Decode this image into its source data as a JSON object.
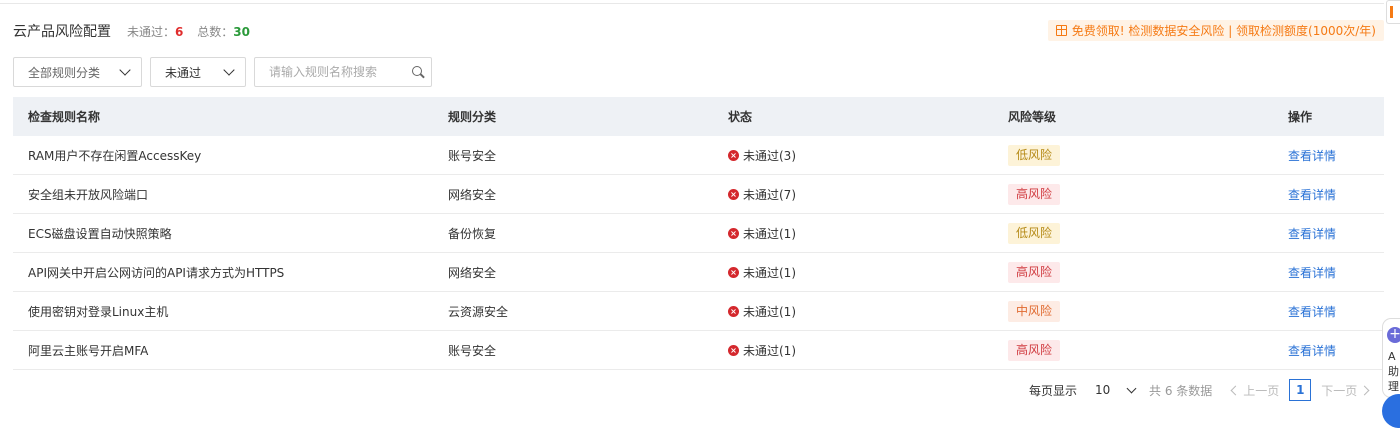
{
  "header": {
    "title": "云产品风险配置",
    "fail_label": "未通过：",
    "fail_count": "6",
    "total_label": "总数：",
    "total_count": "30"
  },
  "promo": {
    "text": "免费领取! 检测数据安全风险 | 领取检测额度(1000次/年)"
  },
  "filters": {
    "category": "全部规则分类",
    "status": "未通过",
    "search_placeholder": "请输入规则名称搜索"
  },
  "table": {
    "columns": [
      "检查规则名称",
      "规则分类",
      "状态",
      "风险等级",
      "操作"
    ],
    "rows": [
      {
        "name": "RAM用户不存在闲置AccessKey",
        "category": "账号安全",
        "status": "未通过(3)",
        "risk": "低风险",
        "action": "查看详情"
      },
      {
        "name": "安全组未开放风险端口",
        "category": "网络安全",
        "status": "未通过(7)",
        "risk": "高风险",
        "action": "查看详情"
      },
      {
        "name": "ECS磁盘设置自动快照策略",
        "category": "备份恢复",
        "status": "未通过(1)",
        "risk": "低风险",
        "action": "查看详情"
      },
      {
        "name": "API网关中开启公网访问的API请求方式为HTTPS",
        "category": "网络安全",
        "status": "未通过(1)",
        "risk": "高风险",
        "action": "查看详情"
      },
      {
        "name": "使用密钥对登录Linux主机",
        "category": "云资源安全",
        "status": "未通过(1)",
        "risk": "中风险",
        "action": "查看详情"
      },
      {
        "name": "阿里云主账号开启MFA",
        "category": "账号安全",
        "status": "未通过(1)",
        "risk": "高风险",
        "action": "查看详情"
      }
    ]
  },
  "pagination": {
    "page_size_label": "每页显示",
    "page_size": "10",
    "count_text": "共 6 条数据",
    "prev": "上一页",
    "page": "1",
    "next": "下一页"
  },
  "assistant": {
    "text": "A\n助\n理"
  },
  "colors": {
    "fail": "#e02d2d",
    "total": "#2b9a3a",
    "link": "#2a72d6",
    "promo": "#f57a14"
  },
  "icons": {
    "status_fail": "close-circle-icon",
    "search": "search-icon",
    "promo": "gift-icon"
  }
}
